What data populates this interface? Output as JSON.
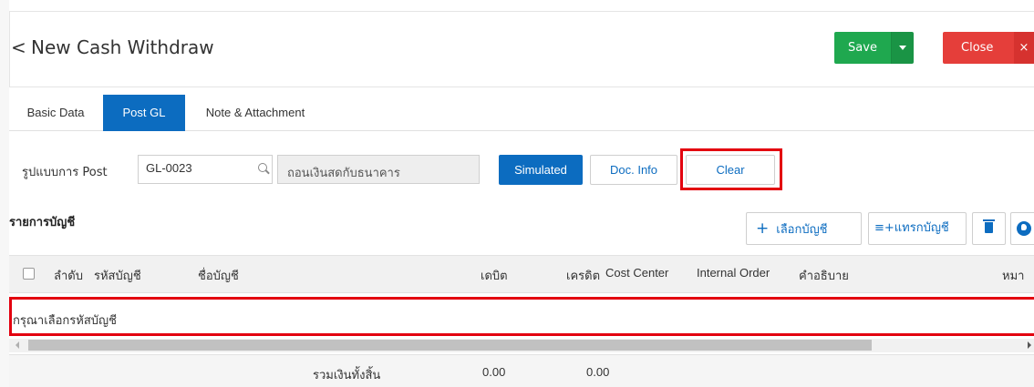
{
  "header": {
    "back_icon": "chevron-left-icon",
    "title": "New Cash Withdraw",
    "save_label": "Save",
    "close_label": "Close",
    "close_x": "×",
    "colors": {
      "save": "#1fa84f",
      "close": "#e53e3a",
      "accent": "#0c6cc0"
    }
  },
  "tabs": [
    {
      "label": "Basic Data",
      "active": false
    },
    {
      "label": "Post GL",
      "active": true
    },
    {
      "label": "Note & Attachment",
      "active": false
    }
  ],
  "post_form": {
    "label": "รูปแบบการ Post",
    "code_value": "GL-0023",
    "description_value": "ถอนเงินสดกับธนาคาร",
    "simulated_label": "Simulated",
    "doc_info_label": "Doc. Info",
    "clear_label": "Clear"
  },
  "accounts": {
    "section_title": "รายการบัญชี",
    "select_account_plus": "+",
    "select_account_label": "เลือกบัญชี",
    "insert_account_label": "≡+แทรกบัญชี",
    "columns": [
      "ลำดับ",
      "รหัสบัญชี",
      "ชื่อบัญชี",
      "เดบิต",
      "เครดิต",
      "Cost Center",
      "Internal Order",
      "คำอธิบาย",
      "หมา"
    ],
    "empty_message": "กรุณาเลือกรหัสบัญชี",
    "total_label": "รวมเงินทั้งสิ้น",
    "total_debit": "0.00",
    "total_credit": "0.00"
  }
}
